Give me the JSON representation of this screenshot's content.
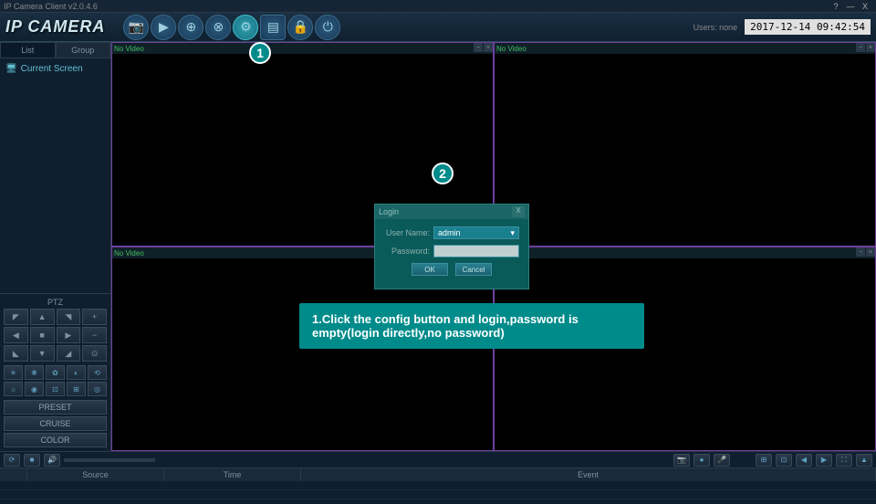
{
  "titlebar": {
    "app_name": "IP Camera Client v2.0.4.6",
    "help": "?",
    "min": "—",
    "close": "X"
  },
  "header": {
    "logo": "IP CAMERA",
    "users_label": "Users: none",
    "timestamp": "2017-12-14 09:42:54"
  },
  "sidebar": {
    "tabs": [
      "List",
      "Group"
    ],
    "tree_item": "Current Screen",
    "ptz_label": "PTZ",
    "preset": "PRESET",
    "cruise": "CRUISE",
    "color": "COLOR"
  },
  "video": {
    "no_video": "No Video"
  },
  "annotations": {
    "b1": "1",
    "b2": "2",
    "instruction": "1.Click the config button and login,password is empty(login directly,no password)"
  },
  "login": {
    "title": "Login",
    "user_label": "User Name:",
    "user_value": "admin",
    "pass_label": "Password:",
    "ok": "OK",
    "cancel": "Cancel"
  },
  "bottom": {
    "cols": [
      "",
      "Source",
      "Time",
      "Event"
    ]
  }
}
